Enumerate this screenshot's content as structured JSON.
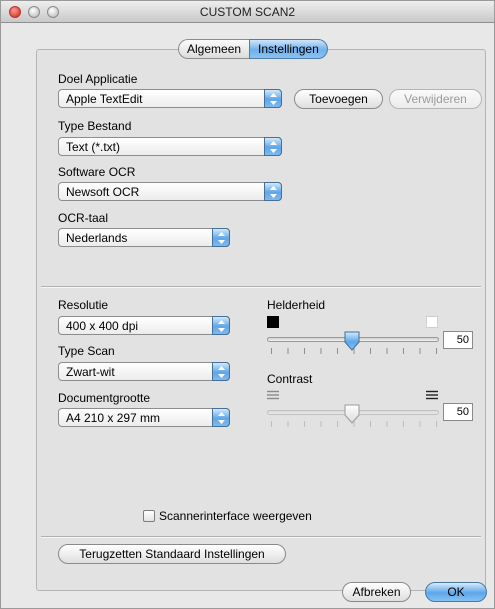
{
  "window": {
    "title": "CUSTOM SCAN2"
  },
  "tabs": [
    {
      "label": "Algemeen",
      "active": false
    },
    {
      "label": "Instellingen",
      "active": true
    }
  ],
  "target_app": {
    "label": "Doel Applicatie",
    "value": "Apple TextEdit",
    "add_button": "Toevoegen",
    "remove_button": "Verwijderen"
  },
  "file_type": {
    "label": "Type Bestand",
    "value": "Text (*.txt)"
  },
  "ocr_software": {
    "label": "Software OCR",
    "value": "Newsoft OCR"
  },
  "ocr_language": {
    "label": "OCR-taal",
    "value": "Nederlands"
  },
  "resolution": {
    "label": "Resolutie",
    "value": "400 x 400 dpi"
  },
  "scan_type": {
    "label": "Type Scan",
    "value": "Zwart-wit"
  },
  "document_size": {
    "label": "Documentgrootte",
    "value": "A4  210 x 297 mm"
  },
  "brightness": {
    "label": "Helderheid",
    "value": "50",
    "level": 0.5
  },
  "contrast": {
    "label": "Contrast",
    "value": "50",
    "level": 0.5,
    "enabled": false
  },
  "scanner_interface": {
    "label": "Scannerinterface weergeven",
    "checked": false
  },
  "reset_button": "Terugzetten Standaard Instellingen",
  "cancel_button": "Afbreken",
  "ok_button": "OK",
  "colors": {
    "accent": "#5ea6e7",
    "close": "#e0443a"
  }
}
